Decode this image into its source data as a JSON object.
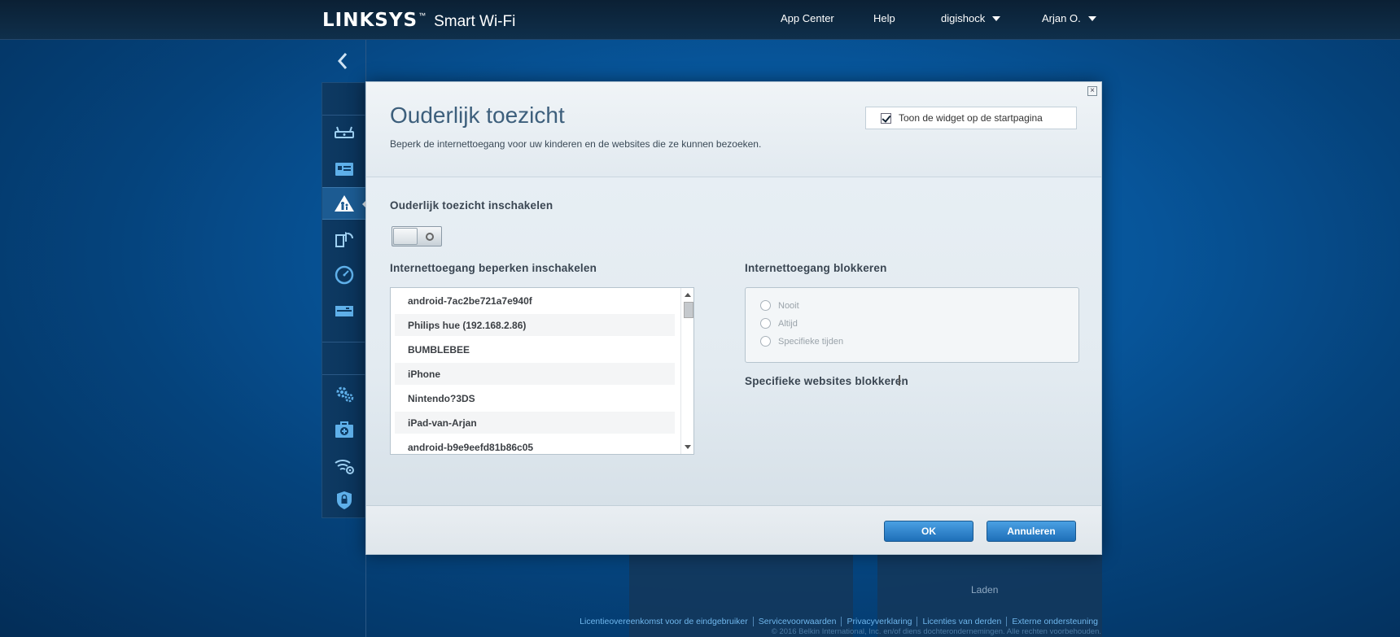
{
  "header": {
    "brand": "LINKSYS",
    "tm": "™",
    "product": "Smart Wi-Fi",
    "nav": {
      "app_center": "App Center",
      "help": "Help",
      "router": "digishock",
      "user": "Arjan O."
    }
  },
  "sidebar": {
    "icons": [
      "router-icon",
      "device-list-icon",
      "parental-controls-icon",
      "media-prioritization-icon",
      "speed-test-icon",
      "external-storage-icon",
      "connectivity-icon",
      "troubleshooting-icon",
      "wireless-icon",
      "security-icon"
    ],
    "active": "parental-controls-icon"
  },
  "background": {
    "tile_text": "Laden"
  },
  "modal": {
    "title": "Ouderlijk toezicht",
    "subtitle": "Beperk de internettoegang voor uw kinderen en de websites die ze kunnen bezoeken.",
    "widget_checkbox_label": "Toon de widget op de startpagina",
    "widget_checked": true,
    "enable_label": "Ouderlijk toezicht inschakelen",
    "enabled": false,
    "restrict_label": "Internettoegang beperken inschakelen",
    "devices": [
      "android-7ac2be721a7e940f",
      "Philips hue (192.168.2.86)",
      "BUMBLEBEE",
      "iPhone",
      "Nintendo?3DS",
      "iPad-van-Arjan",
      "android-b9e9eefd81b86c05"
    ],
    "block_label": "Internettoegang blokkeren",
    "block_options": [
      "Nooit",
      "Altijd",
      "Specifieke tijden"
    ],
    "websites_label": "Specifieke websites blokkeren",
    "ok_label": "OK",
    "cancel_label": "Annuleren",
    "close_glyph": "×"
  },
  "footer": {
    "links": [
      "Licentieovereenkomst voor de eindgebruiker",
      "Servicevoorwaarden",
      "Privacyverklaring",
      "Licenties van derden",
      "Externe ondersteuning"
    ],
    "copyright": "© 2016 Belkin International, Inc. en/of diens dochterondernemingen. Alle rechten voorbehouden."
  },
  "colors": {
    "accent": "#1e6fb8",
    "header_bg": "#0b2034",
    "background": "#07559a"
  }
}
